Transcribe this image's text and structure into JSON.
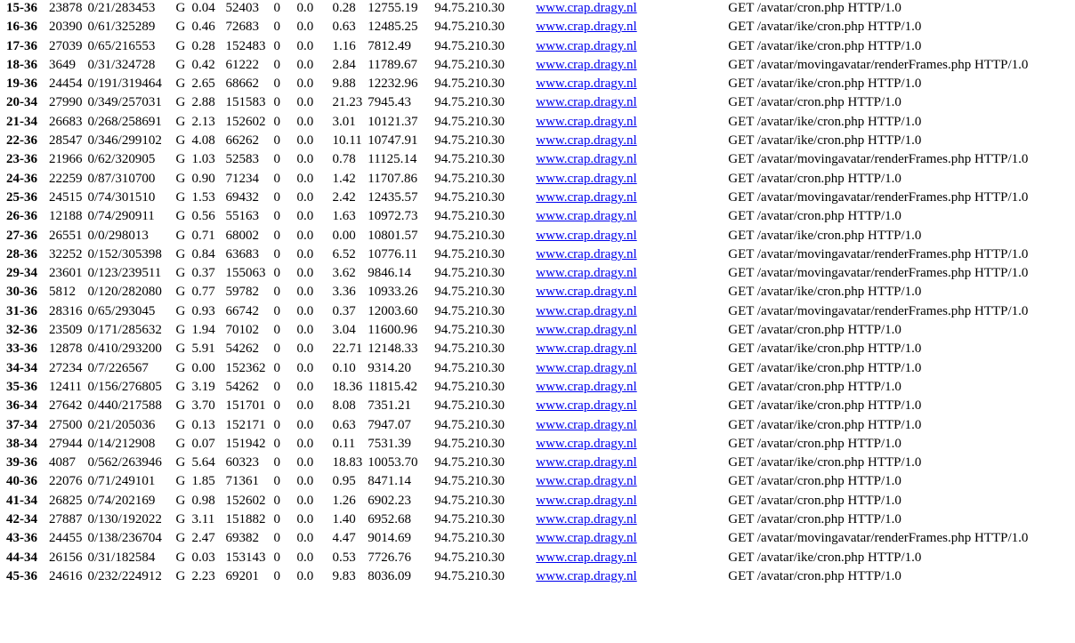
{
  "scoreboard": {
    "rows": [
      {
        "srv": "15-36",
        "pid": "23878",
        "acc": "0/21/283453",
        "m": "G",
        "cpu": "0.04",
        "ss": "52403",
        "req": "0",
        "conn": "0.0",
        "child": "0.28",
        "slot": "12755.19",
        "client": "94.75.210.30",
        "vhost": "www.crap.dragy.nl",
        "request": "GET /avatar/cron.php HTTP/1.0"
      },
      {
        "srv": "16-36",
        "pid": "20390",
        "acc": "0/61/325289",
        "m": "G",
        "cpu": "0.46",
        "ss": "72683",
        "req": "0",
        "conn": "0.0",
        "child": "0.63",
        "slot": "12485.25",
        "client": "94.75.210.30",
        "vhost": "www.crap.dragy.nl",
        "request": "GET /avatar/ike/cron.php HTTP/1.0"
      },
      {
        "srv": "17-36",
        "pid": "27039",
        "acc": "0/65/216553",
        "m": "G",
        "cpu": "0.28",
        "ss": "152483",
        "req": "0",
        "conn": "0.0",
        "child": "1.16",
        "slot": "7812.49",
        "client": "94.75.210.30",
        "vhost": "www.crap.dragy.nl",
        "request": "GET /avatar/ike/cron.php HTTP/1.0"
      },
      {
        "srv": "18-36",
        "pid": "3649",
        "acc": "0/31/324728",
        "m": "G",
        "cpu": "0.42",
        "ss": "61222",
        "req": "0",
        "conn": "0.0",
        "child": "2.84",
        "slot": "11789.67",
        "client": "94.75.210.30",
        "vhost": "www.crap.dragy.nl",
        "request": "GET /avatar/movingavatar/renderFrames.php HTTP/1.0"
      },
      {
        "srv": "19-36",
        "pid": "24454",
        "acc": "0/191/319464",
        "m": "G",
        "cpu": "2.65",
        "ss": "68662",
        "req": "0",
        "conn": "0.0",
        "child": "9.88",
        "slot": "12232.96",
        "client": "94.75.210.30",
        "vhost": "www.crap.dragy.nl",
        "request": "GET /avatar/ike/cron.php HTTP/1.0"
      },
      {
        "srv": "20-34",
        "pid": "27990",
        "acc": "0/349/257031",
        "m": "G",
        "cpu": "2.88",
        "ss": "151583",
        "req": "0",
        "conn": "0.0",
        "child": "21.23",
        "slot": "7945.43",
        "client": "94.75.210.30",
        "vhost": "www.crap.dragy.nl",
        "request": "GET /avatar/cron.php HTTP/1.0"
      },
      {
        "srv": "21-34",
        "pid": "26683",
        "acc": "0/268/258691",
        "m": "G",
        "cpu": "2.13",
        "ss": "152602",
        "req": "0",
        "conn": "0.0",
        "child": "3.01",
        "slot": "10121.37",
        "client": "94.75.210.30",
        "vhost": "www.crap.dragy.nl",
        "request": "GET /avatar/ike/cron.php HTTP/1.0"
      },
      {
        "srv": "22-36",
        "pid": "28547",
        "acc": "0/346/299102",
        "m": "G",
        "cpu": "4.08",
        "ss": "66262",
        "req": "0",
        "conn": "0.0",
        "child": "10.11",
        "slot": "10747.91",
        "client": "94.75.210.30",
        "vhost": "www.crap.dragy.nl",
        "request": "GET /avatar/ike/cron.php HTTP/1.0"
      },
      {
        "srv": "23-36",
        "pid": "21966",
        "acc": "0/62/320905",
        "m": "G",
        "cpu": "1.03",
        "ss": "52583",
        "req": "0",
        "conn": "0.0",
        "child": "0.78",
        "slot": "11125.14",
        "client": "94.75.210.30",
        "vhost": "www.crap.dragy.nl",
        "request": "GET /avatar/movingavatar/renderFrames.php HTTP/1.0"
      },
      {
        "srv": "24-36",
        "pid": "22259",
        "acc": "0/87/310700",
        "m": "G",
        "cpu": "0.90",
        "ss": "71234",
        "req": "0",
        "conn": "0.0",
        "child": "1.42",
        "slot": "11707.86",
        "client": "94.75.210.30",
        "vhost": "www.crap.dragy.nl",
        "request": "GET /avatar/cron.php HTTP/1.0"
      },
      {
        "srv": "25-36",
        "pid": "24515",
        "acc": "0/74/301510",
        "m": "G",
        "cpu": "1.53",
        "ss": "69432",
        "req": "0",
        "conn": "0.0",
        "child": "2.42",
        "slot": "12435.57",
        "client": "94.75.210.30",
        "vhost": "www.crap.dragy.nl",
        "request": "GET /avatar/movingavatar/renderFrames.php HTTP/1.0"
      },
      {
        "srv": "26-36",
        "pid": "12188",
        "acc": "0/74/290911",
        "m": "G",
        "cpu": "0.56",
        "ss": "55163",
        "req": "0",
        "conn": "0.0",
        "child": "1.63",
        "slot": "10972.73",
        "client": "94.75.210.30",
        "vhost": "www.crap.dragy.nl",
        "request": "GET /avatar/cron.php HTTP/1.0"
      },
      {
        "srv": "27-36",
        "pid": "26551",
        "acc": "0/0/298013",
        "m": "G",
        "cpu": "0.71",
        "ss": "68002",
        "req": "0",
        "conn": "0.0",
        "child": "0.00",
        "slot": "10801.57",
        "client": "94.75.210.30",
        "vhost": "www.crap.dragy.nl",
        "request": "GET /avatar/ike/cron.php HTTP/1.0"
      },
      {
        "srv": "28-36",
        "pid": "32252",
        "acc": "0/152/305398",
        "m": "G",
        "cpu": "0.84",
        "ss": "63683",
        "req": "0",
        "conn": "0.0",
        "child": "6.52",
        "slot": "10776.11",
        "client": "94.75.210.30",
        "vhost": "www.crap.dragy.nl",
        "request": "GET /avatar/movingavatar/renderFrames.php HTTP/1.0"
      },
      {
        "srv": "29-34",
        "pid": "23601",
        "acc": "0/123/239511",
        "m": "G",
        "cpu": "0.37",
        "ss": "155063",
        "req": "0",
        "conn": "0.0",
        "child": "3.62",
        "slot": "9846.14",
        "client": "94.75.210.30",
        "vhost": "www.crap.dragy.nl",
        "request": "GET /avatar/movingavatar/renderFrames.php HTTP/1.0"
      },
      {
        "srv": "30-36",
        "pid": "5812",
        "acc": "0/120/282080",
        "m": "G",
        "cpu": "0.77",
        "ss": "59782",
        "req": "0",
        "conn": "0.0",
        "child": "3.36",
        "slot": "10933.26",
        "client": "94.75.210.30",
        "vhost": "www.crap.dragy.nl",
        "request": "GET /avatar/ike/cron.php HTTP/1.0"
      },
      {
        "srv": "31-36",
        "pid": "28316",
        "acc": "0/65/293045",
        "m": "G",
        "cpu": "0.93",
        "ss": "66742",
        "req": "0",
        "conn": "0.0",
        "child": "0.37",
        "slot": "12003.60",
        "client": "94.75.210.30",
        "vhost": "www.crap.dragy.nl",
        "request": "GET /avatar/movingavatar/renderFrames.php HTTP/1.0"
      },
      {
        "srv": "32-36",
        "pid": "23509",
        "acc": "0/171/285632",
        "m": "G",
        "cpu": "1.94",
        "ss": "70102",
        "req": "0",
        "conn": "0.0",
        "child": "3.04",
        "slot": "11600.96",
        "client": "94.75.210.30",
        "vhost": "www.crap.dragy.nl",
        "request": "GET /avatar/cron.php HTTP/1.0"
      },
      {
        "srv": "33-36",
        "pid": "12878",
        "acc": "0/410/293200",
        "m": "G",
        "cpu": "5.91",
        "ss": "54262",
        "req": "0",
        "conn": "0.0",
        "child": "22.71",
        "slot": "12148.33",
        "client": "94.75.210.30",
        "vhost": "www.crap.dragy.nl",
        "request": "GET /avatar/ike/cron.php HTTP/1.0"
      },
      {
        "srv": "34-34",
        "pid": "27234",
        "acc": "0/7/226567",
        "m": "G",
        "cpu": "0.00",
        "ss": "152362",
        "req": "0",
        "conn": "0.0",
        "child": "0.10",
        "slot": "9314.20",
        "client": "94.75.210.30",
        "vhost": "www.crap.dragy.nl",
        "request": "GET /avatar/ike/cron.php HTTP/1.0"
      },
      {
        "srv": "35-36",
        "pid": "12411",
        "acc": "0/156/276805",
        "m": "G",
        "cpu": "3.19",
        "ss": "54262",
        "req": "0",
        "conn": "0.0",
        "child": "18.36",
        "slot": "11815.42",
        "client": "94.75.210.30",
        "vhost": "www.crap.dragy.nl",
        "request": "GET /avatar/cron.php HTTP/1.0"
      },
      {
        "srv": "36-34",
        "pid": "27642",
        "acc": "0/440/217588",
        "m": "G",
        "cpu": "3.70",
        "ss": "151701",
        "req": "0",
        "conn": "0.0",
        "child": "8.08",
        "slot": "7351.21",
        "client": "94.75.210.30",
        "vhost": "www.crap.dragy.nl",
        "request": "GET /avatar/ike/cron.php HTTP/1.0"
      },
      {
        "srv": "37-34",
        "pid": "27500",
        "acc": "0/21/205036",
        "m": "G",
        "cpu": "0.13",
        "ss": "152171",
        "req": "0",
        "conn": "0.0",
        "child": "0.63",
        "slot": "7947.07",
        "client": "94.75.210.30",
        "vhost": "www.crap.dragy.nl",
        "request": "GET /avatar/ike/cron.php HTTP/1.0"
      },
      {
        "srv": "38-34",
        "pid": "27944",
        "acc": "0/14/212908",
        "m": "G",
        "cpu": "0.07",
        "ss": "151942",
        "req": "0",
        "conn": "0.0",
        "child": "0.11",
        "slot": "7531.39",
        "client": "94.75.210.30",
        "vhost": "www.crap.dragy.nl",
        "request": "GET /avatar/cron.php HTTP/1.0"
      },
      {
        "srv": "39-36",
        "pid": "4087",
        "acc": "0/562/263946",
        "m": "G",
        "cpu": "5.64",
        "ss": "60323",
        "req": "0",
        "conn": "0.0",
        "child": "18.83",
        "slot": "10053.70",
        "client": "94.75.210.30",
        "vhost": "www.crap.dragy.nl",
        "request": "GET /avatar/ike/cron.php HTTP/1.0"
      },
      {
        "srv": "40-36",
        "pid": "22076",
        "acc": "0/71/249101",
        "m": "G",
        "cpu": "1.85",
        "ss": "71361",
        "req": "0",
        "conn": "0.0",
        "child": "0.95",
        "slot": "8471.14",
        "client": "94.75.210.30",
        "vhost": "www.crap.dragy.nl",
        "request": "GET /avatar/cron.php HTTP/1.0"
      },
      {
        "srv": "41-34",
        "pid": "26825",
        "acc": "0/74/202169",
        "m": "G",
        "cpu": "0.98",
        "ss": "152602",
        "req": "0",
        "conn": "0.0",
        "child": "1.26",
        "slot": "6902.23",
        "client": "94.75.210.30",
        "vhost": "www.crap.dragy.nl",
        "request": "GET /avatar/cron.php HTTP/1.0"
      },
      {
        "srv": "42-34",
        "pid": "27887",
        "acc": "0/130/192022",
        "m": "G",
        "cpu": "3.11",
        "ss": "151882",
        "req": "0",
        "conn": "0.0",
        "child": "1.40",
        "slot": "6952.68",
        "client": "94.75.210.30",
        "vhost": "www.crap.dragy.nl",
        "request": "GET /avatar/cron.php HTTP/1.0"
      },
      {
        "srv": "43-36",
        "pid": "24455",
        "acc": "0/138/236704",
        "m": "G",
        "cpu": "2.47",
        "ss": "69382",
        "req": "0",
        "conn": "0.0",
        "child": "4.47",
        "slot": "9014.69",
        "client": "94.75.210.30",
        "vhost": "www.crap.dragy.nl",
        "request": "GET /avatar/movingavatar/renderFrames.php HTTP/1.0"
      },
      {
        "srv": "44-34",
        "pid": "26156",
        "acc": "0/31/182584",
        "m": "G",
        "cpu": "0.03",
        "ss": "153143",
        "req": "0",
        "conn": "0.0",
        "child": "0.53",
        "slot": "7726.76",
        "client": "94.75.210.30",
        "vhost": "www.crap.dragy.nl",
        "request": "GET /avatar/ike/cron.php HTTP/1.0"
      },
      {
        "srv": "45-36",
        "pid": "24616",
        "acc": "0/232/224912",
        "m": "G",
        "cpu": "2.23",
        "ss": "69201",
        "req": "0",
        "conn": "0.0",
        "child": "9.83",
        "slot": "8036.09",
        "client": "94.75.210.30",
        "vhost": "www.crap.dragy.nl",
        "request": "GET /avatar/cron.php HTTP/1.0"
      }
    ]
  }
}
